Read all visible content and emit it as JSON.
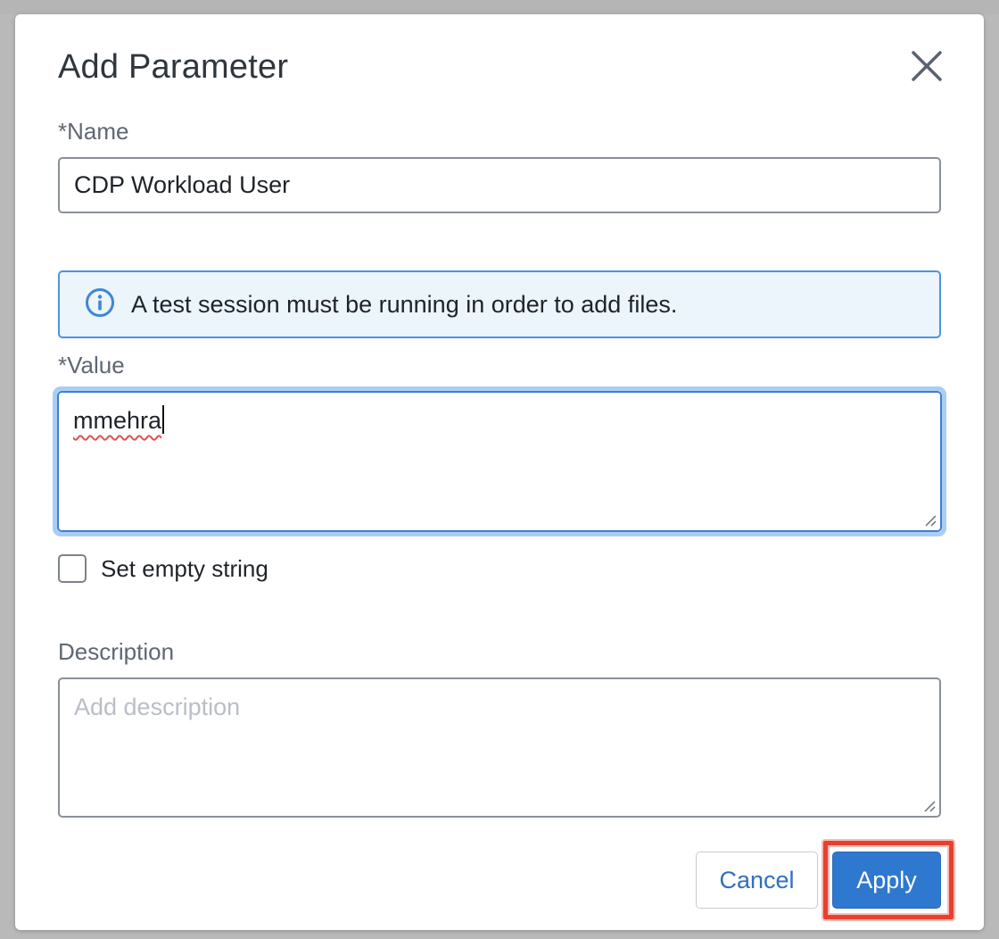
{
  "dialog": {
    "title": "Add Parameter",
    "close_icon": "close-icon"
  },
  "name_field": {
    "label": "*Name",
    "value": "CDP Workload User"
  },
  "info_banner": {
    "icon": "info-icon",
    "text": "A test session must be running in order to add files."
  },
  "value_field": {
    "label": "*Value",
    "value": "mmehra"
  },
  "empty_string_checkbox": {
    "label": "Set empty string",
    "checked": false
  },
  "description_field": {
    "label": "Description",
    "placeholder": "Add description",
    "value": ""
  },
  "buttons": {
    "cancel_label": "Cancel",
    "apply_label": "Apply"
  },
  "colors": {
    "primary": "#2f78d0",
    "info_border": "#4c94de",
    "info_background": "#ecf4fc",
    "highlight": "#e8402e"
  }
}
